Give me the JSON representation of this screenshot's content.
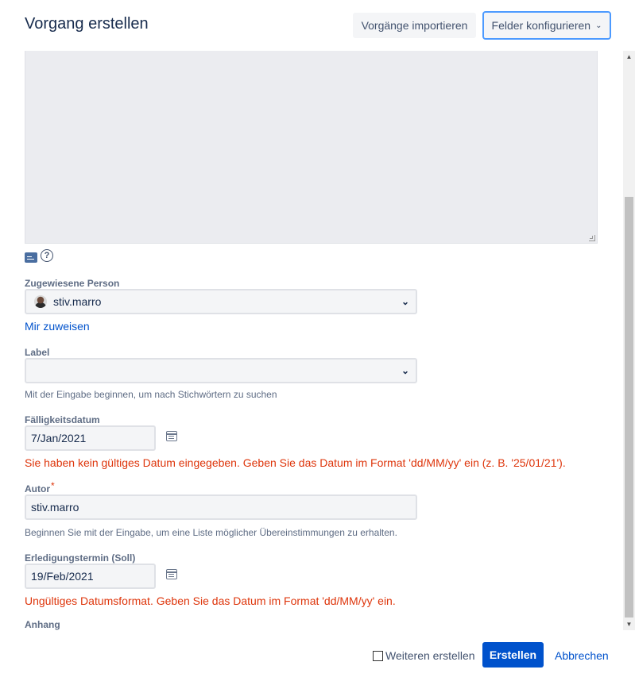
{
  "dialog": {
    "title": "Vorgang erstellen",
    "import_label": "Vorgänge importieren",
    "configure_label": "Felder konfigurieren"
  },
  "description": {
    "help_icon": "question-circle-icon",
    "text_icon": "text-mode-icon"
  },
  "assignee": {
    "label": "Zugewiesene Person",
    "value": "stiv.marro",
    "assign_to_me": "Mir zuweisen"
  },
  "labels": {
    "label": "Label",
    "value": "",
    "hint": "Mit der Eingabe beginnen, um nach Stichwörtern zu suchen"
  },
  "due_date": {
    "label": "Fälligkeitsdatum",
    "value": "7/Jan/2021",
    "error": "Sie haben kein gültiges Datum eingegeben. Geben Sie das Datum im Format 'dd/MM/yy' ein (z. B. '25/01/21')."
  },
  "author": {
    "label": "Autor",
    "required_mark": "*",
    "value": "stiv.marro",
    "hint": "Beginnen Sie mit der Eingabe, um eine Liste möglicher Übereinstimmungen zu erhalten."
  },
  "target_date": {
    "label": "Erledigungstermin (Soll)",
    "value": "19/Feb/2021",
    "error": "Ungültiges Datumsformat. Geben Sie das Datum im Format 'dd/MM/yy' ein."
  },
  "attachment": {
    "label": "Anhang"
  },
  "footer": {
    "create_another": "Weiteren erstellen",
    "create": "Erstellen",
    "cancel": "Abbrechen"
  },
  "colors": {
    "primary": "#0052cc",
    "error": "#de350b",
    "focus": "#4c9aff"
  }
}
